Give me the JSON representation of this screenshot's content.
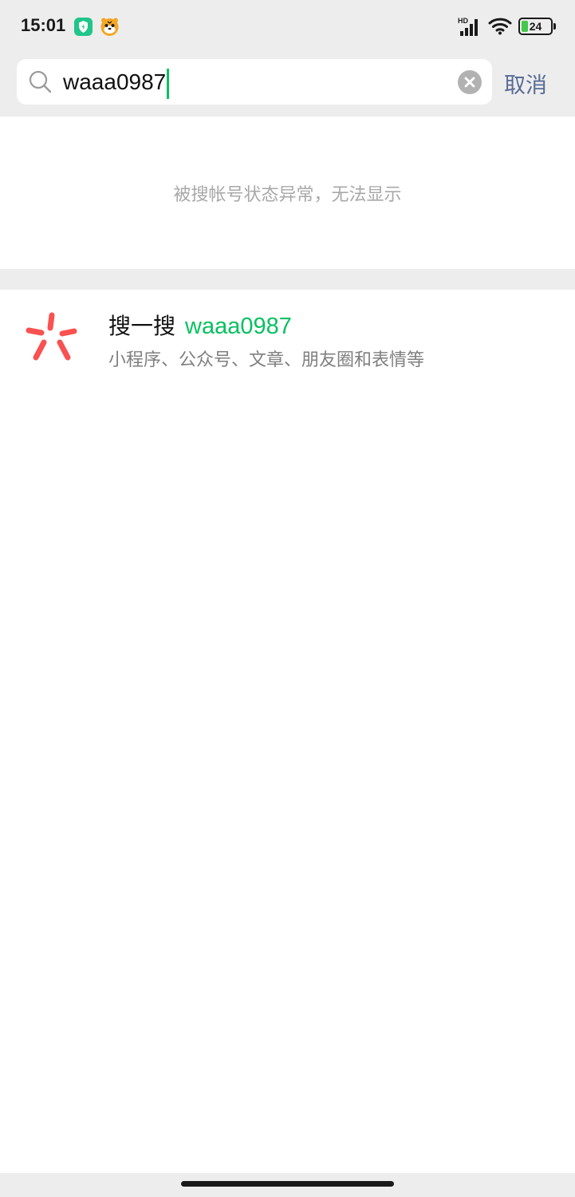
{
  "status_bar": {
    "time": "15:01",
    "signal_label": "HD",
    "battery_level": 24,
    "battery_text": "24",
    "icons": [
      "shield-app-icon",
      "tiger-app-icon",
      "signal-icon",
      "wifi-icon",
      "battery-icon"
    ]
  },
  "search": {
    "value": "waaa0987",
    "placeholder": "",
    "cancel_label": "取消",
    "accent_color": "#07c160"
  },
  "notice": {
    "text": "被搜帐号状态异常，无法显示"
  },
  "sousou": {
    "title": "搜一搜",
    "keyword": "waaa0987",
    "subtitle": "小程序、公众号、文章、朋友圈和表情等",
    "icon_color": "#fa5151"
  },
  "colors": {
    "header_bg": "#ededed",
    "link_blue": "#576b95",
    "keyword_green": "#07c160"
  }
}
